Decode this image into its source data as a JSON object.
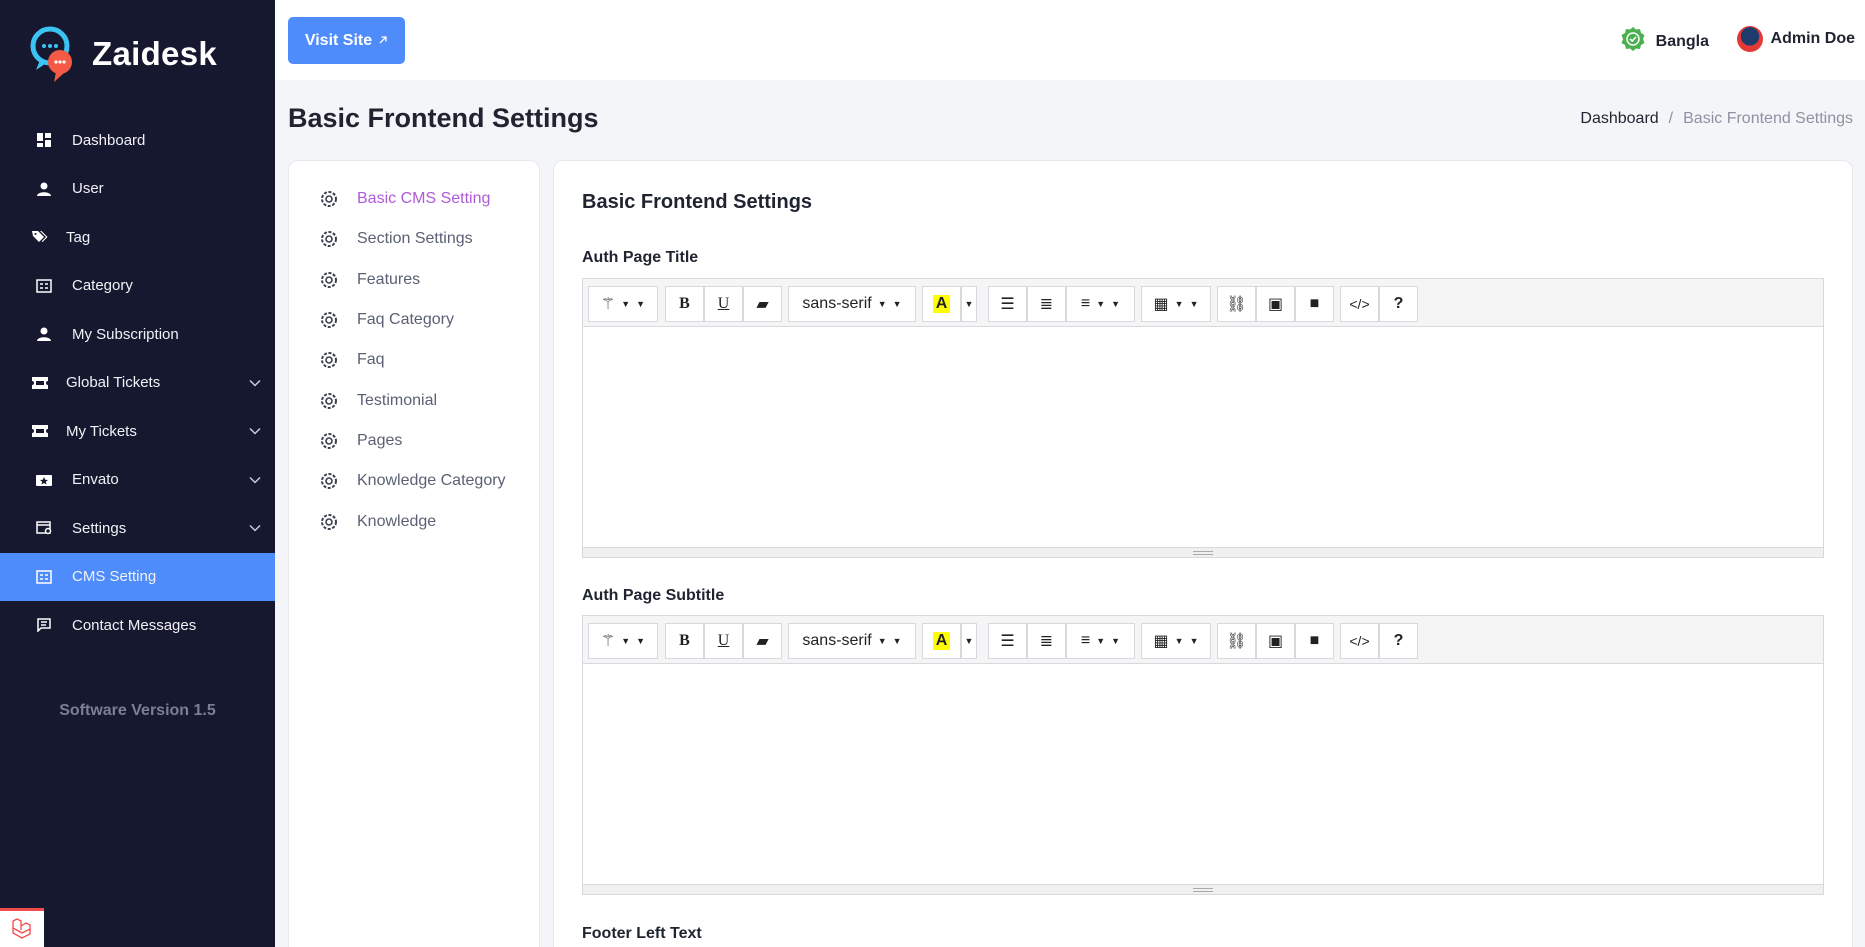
{
  "brand": {
    "name": "Zaidesk"
  },
  "sidebar": {
    "items": [
      {
        "label": "Dashboard",
        "icon": "dashboard-icon",
        "has_submenu": false
      },
      {
        "label": "User",
        "icon": "user-icon",
        "has_submenu": false
      },
      {
        "label": "Tag",
        "icon": "tag-icon",
        "has_submenu": false
      },
      {
        "label": "Category",
        "icon": "category-icon",
        "has_submenu": false
      },
      {
        "label": "My Subscription",
        "icon": "user-icon",
        "has_submenu": false
      },
      {
        "label": "Global Tickets",
        "icon": "ticket-icon",
        "has_submenu": true
      },
      {
        "label": "My Tickets",
        "icon": "ticket-icon",
        "has_submenu": true
      },
      {
        "label": "Envato",
        "icon": "envato-icon",
        "has_submenu": true
      },
      {
        "label": "Settings",
        "icon": "settings-icon",
        "has_submenu": true
      },
      {
        "label": "CMS Setting",
        "icon": "cms-icon",
        "has_submenu": false,
        "active": true
      },
      {
        "label": "Contact Messages",
        "icon": "message-icon",
        "has_submenu": false
      }
    ],
    "version": "Software Version 1.5"
  },
  "header": {
    "visit_site_label": "Visit Site",
    "language": "Bangla",
    "user_name": "Admin Doe"
  },
  "page": {
    "title": "Basic Frontend Settings",
    "breadcrumb": {
      "link": "Dashboard",
      "separator": "/",
      "current": "Basic Frontend Settings"
    }
  },
  "settings_menu": {
    "items": [
      {
        "label": "Basic CMS Setting",
        "active": true
      },
      {
        "label": "Section Settings"
      },
      {
        "label": "Features"
      },
      {
        "label": "Faq Category"
      },
      {
        "label": "Faq"
      },
      {
        "label": "Testimonial"
      },
      {
        "label": "Pages"
      },
      {
        "label": "Knowledge Category"
      },
      {
        "label": "Knowledge"
      }
    ]
  },
  "form": {
    "title": "Basic Frontend Settings",
    "fields": [
      {
        "label": "Auth Page Title",
        "value": ""
      },
      {
        "label": "Auth Page Subtitle",
        "value": ""
      },
      {
        "label": "Footer Left Text",
        "value": ""
      }
    ],
    "editor_toolbar": {
      "font_family": "sans-serif",
      "buttons": [
        "magic-icon",
        "bold-icon",
        "underline-icon",
        "eraser-icon",
        "font-family-select",
        "highlight-icon",
        "unordered-list-icon",
        "ordered-list-icon",
        "align-icon",
        "table-icon",
        "link-icon",
        "image-icon",
        "video-icon",
        "code-view-icon",
        "help-icon"
      ]
    }
  },
  "colors": {
    "sidebar_bg": "#161830",
    "accent": "#4f8cfb",
    "active_menu_text": "#b05ad9"
  }
}
